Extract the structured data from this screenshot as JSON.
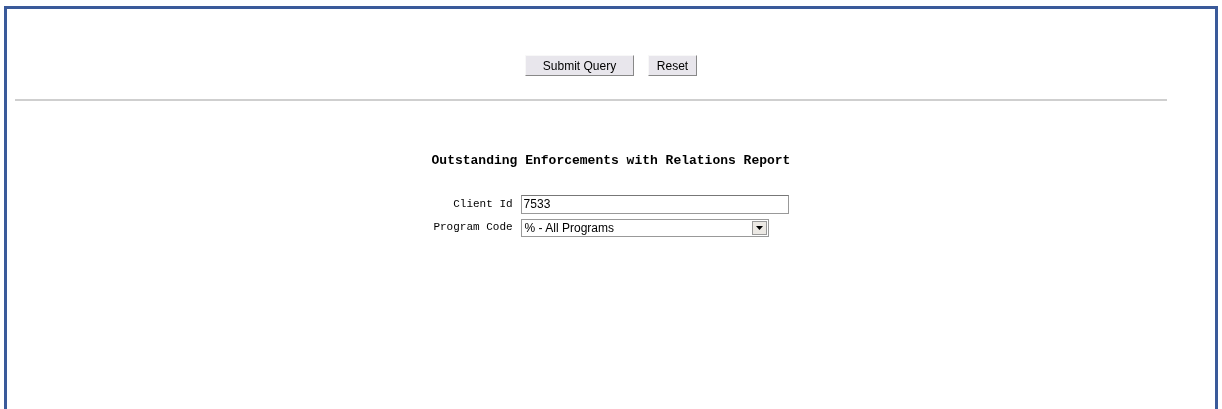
{
  "buttons": [
    "Submit Query",
    "Reset"
  ],
  "report": {
    "title": "Outstanding Enforcements with Relations Report"
  },
  "fields": [
    {
      "label": "Client Id",
      "kind": "text",
      "value": "7533"
    },
    {
      "label": "Program Code",
      "kind": "select",
      "value": "% - All Programs"
    }
  ]
}
